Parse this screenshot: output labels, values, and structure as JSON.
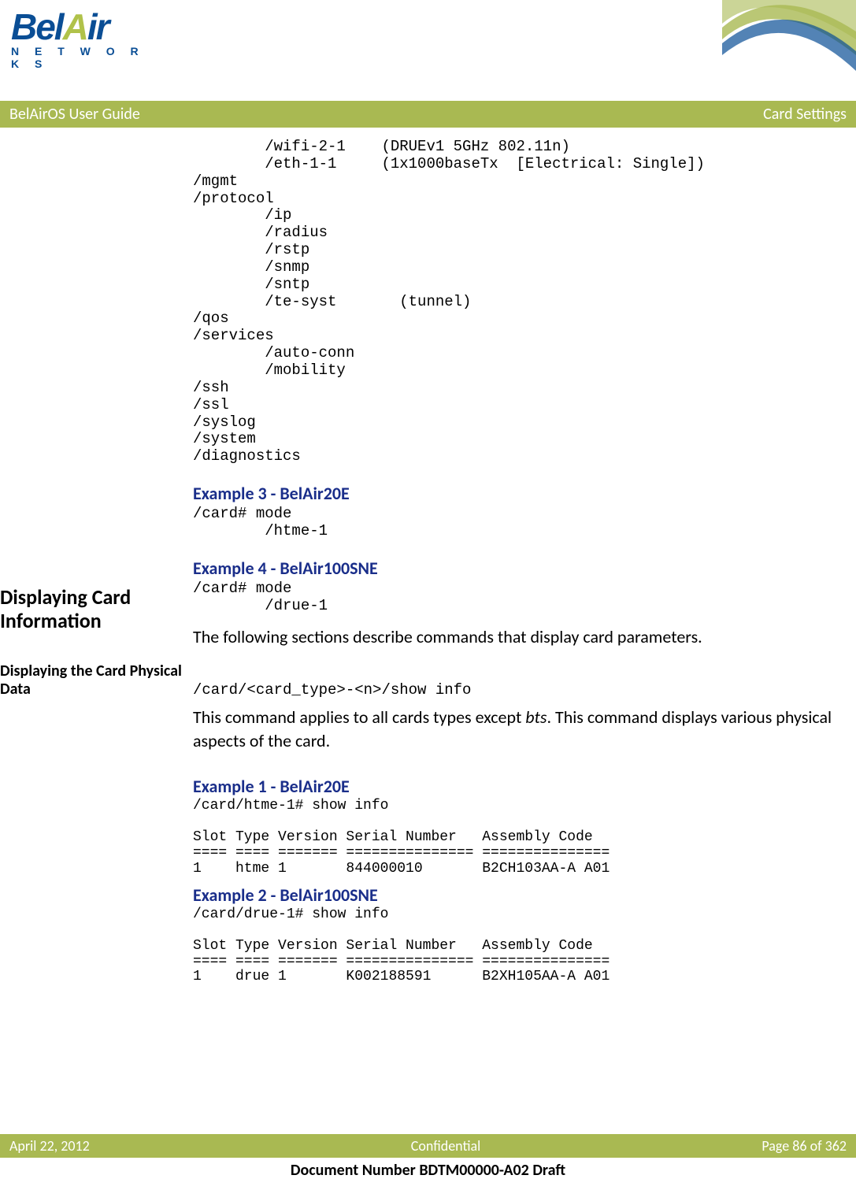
{
  "logo": {
    "bel": "Bel",
    "a": "A",
    "ir": "ir",
    "networks": "N E T W O R K S"
  },
  "header": {
    "left": "BelAirOS User Guide",
    "right": "Card Settings"
  },
  "tree": "        /wifi-2-1    (DRUEv1 5GHz 802.11n)\n        /eth-1-1     (1x1000baseTx  [Electrical: Single])\n/mgmt\n/protocol\n        /ip\n        /radius\n        /rstp\n        /snmp\n        /sntp\n        /te-syst       (tunnel)\n/qos\n/services\n        /auto-conn\n        /mobility\n/ssh\n/ssl\n/syslog\n/system\n/diagnostics",
  "ex3": {
    "title": "Example 3 - BelAir20E",
    "code": "/card# mode\n        /htme-1"
  },
  "ex4": {
    "title": "Example 4 - BelAir100SNE",
    "code": "/card# mode\n        /drue-1"
  },
  "section1": {
    "title": "Displaying Card Information",
    "body": "The following sections describe commands that display card parameters."
  },
  "section2": {
    "title": "Displaying the Card Physical Data",
    "cmd": "/card/<card_type>-<n>/show info",
    "body1": "This command applies to all cards types except ",
    "body1_em": "bts",
    "body1_after": ". This command displays various physical aspects of the card."
  },
  "ex1b": {
    "title": "Example 1 - BelAir20E",
    "code": "/card/htme-1# show info\n\nSlot Type Version Serial Number   Assembly Code\n==== ==== ======= =============== ===============\n1    htme 1       844000010       B2CH103AA-A A01"
  },
  "ex2b": {
    "title": "Example 2 - BelAir100SNE",
    "code": "/card/drue-1# show info\n\nSlot Type Version Serial Number   Assembly Code\n==== ==== ======= =============== ===============\n1    drue 1       K002188591      B2XH105AA-A A01"
  },
  "footer": {
    "date": "April 22, 2012",
    "conf": "Confidential",
    "page": "Page 86 of 362",
    "docnum": "Document Number BDTM00000-A02 Draft"
  }
}
